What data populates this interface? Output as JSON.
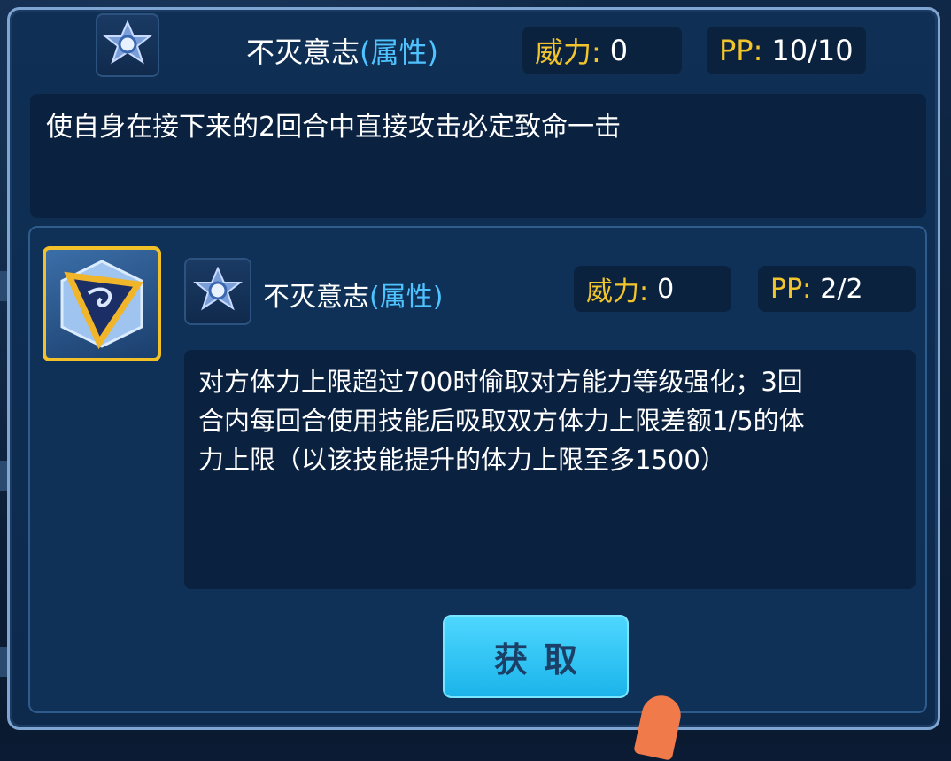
{
  "top_skill": {
    "name": "不灭意志",
    "attr": "(属性)",
    "power_label": "威力:",
    "power_value": "0",
    "pp_label": "PP:",
    "pp_value": "10/10",
    "description": "使自身在接下来的2回合中直接攻击必定致命一击",
    "icon": "star-gem-icon"
  },
  "bottom_skill": {
    "name": "不灭意志",
    "attr": "(属性)",
    "power_label": "威力:",
    "power_value": "0",
    "pp_label": "PP:",
    "pp_value": "2/2",
    "description_lines": [
      "对方体力上限超过700时偷取对方能力等级强化；3回",
      "合内每回合使用技能后吸取双方体力上限差额1/5的体",
      "力上限（以该技能提升的体力上限至多1500）"
    ],
    "icon": "star-gem-icon",
    "item_icon": "dragon-crystal-icon"
  },
  "action": {
    "get_label": "获取"
  },
  "colors": {
    "panel_border": "#7fa6d2",
    "stat_label": "#f3c52c",
    "attr_text": "#4fc3ff",
    "button": "#1ab3ea",
    "gem_frame": "#f2c12a"
  }
}
